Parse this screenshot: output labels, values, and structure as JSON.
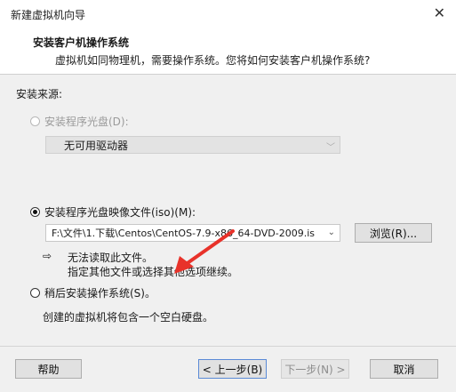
{
  "window": {
    "title": "新建虚拟机向导"
  },
  "header": {
    "title": "安装客户机操作系统",
    "subtitle": "虚拟机如同物理机，需要操作系统。您将如何安装客户机操作系统?"
  },
  "source": {
    "label": "安装来源:",
    "disc_option": "安装程序光盘(D):",
    "disc_select": "无可用驱动器",
    "iso_option": "安装程序光盘映像文件(iso)(M):",
    "iso_path": "F:\\文件\\1.下载\\Centos\\CentOS-7.9-x86_64-DVD-2009.is",
    "browse_label": "浏览(R)...",
    "warn_line1": "无法读取此文件。",
    "warn_line2": "指定其他文件或选择其他选项继续。",
    "later_option": "稍后安装操作系统(S)。",
    "later_desc": "创建的虚拟机将包含一个空白硬盘。"
  },
  "footer": {
    "help": "帮助",
    "back": "< 上一步(B)",
    "next": "下一步(N) >",
    "cancel": "取消"
  },
  "colors": {
    "annotation_arrow": "#e8322a",
    "focus_border": "#5a8ad6"
  }
}
